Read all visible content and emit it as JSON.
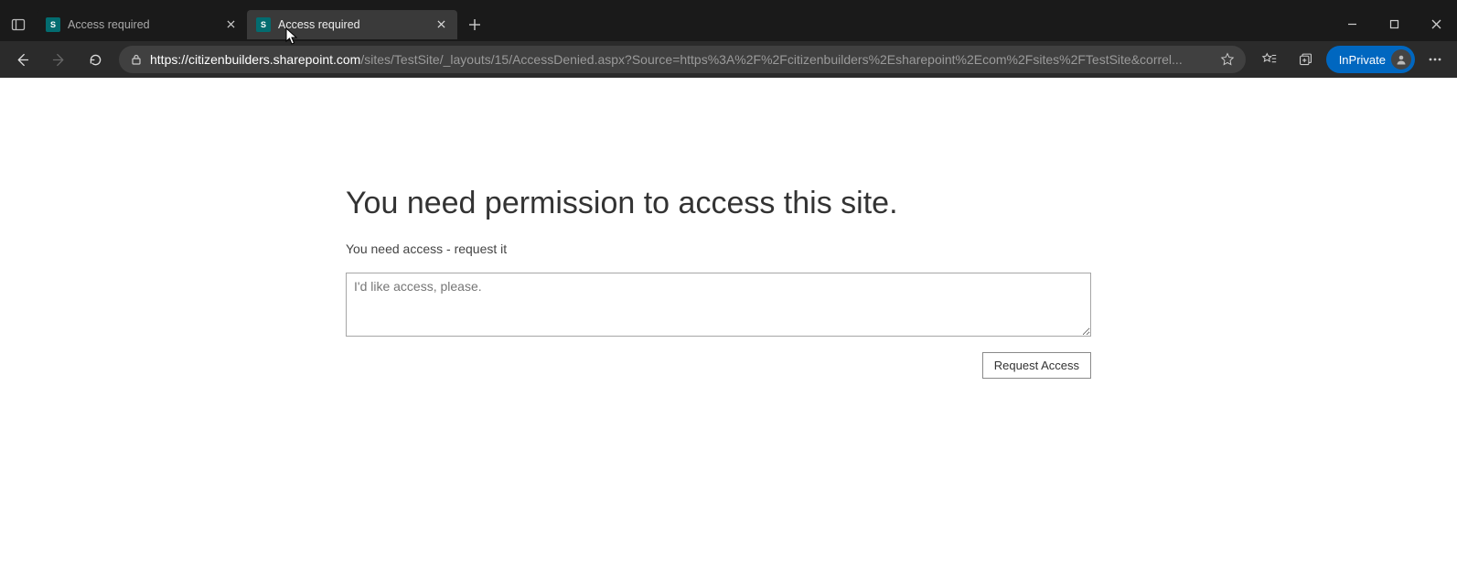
{
  "browser": {
    "tabs": [
      {
        "title": "Access required"
      },
      {
        "title": "Access required"
      }
    ],
    "address_host": "https://citizenbuilders.sharepoint.com",
    "address_path": "/sites/TestSite/_layouts/15/AccessDenied.aspx?Source=https%3A%2F%2Fcitizenbuilders%2Esharepoint%2Ecom%2Fsites%2FTestSite&correl...",
    "inprivate_label": "InPrivate"
  },
  "page": {
    "heading": "You need permission to access this site.",
    "subtext": "You need access - request it",
    "textarea_placeholder": "I'd like access, please.",
    "request_button": "Request Access"
  }
}
